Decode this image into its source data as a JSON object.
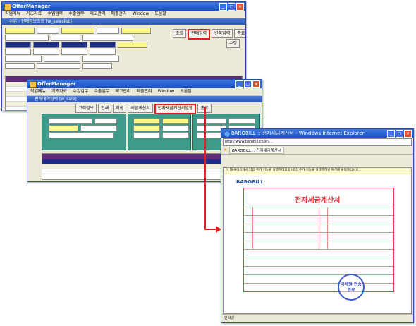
{
  "window1": {
    "title": "OfferManager",
    "menu": [
      "작업메뉴",
      "기초자료",
      "수입업무",
      "수출업무",
      "재고관리",
      "매출관리",
      "Window",
      "도움말"
    ],
    "subtitle": "수입 - 판매정보조회 [w_saleslist]",
    "toolbar": {
      "search": "조회",
      "sales_input": "판매입력",
      "return_input": "반품입력",
      "close": "종료",
      "print": "수정"
    }
  },
  "window2": {
    "title": "OfferManager",
    "menu": [
      "작업메뉴",
      "기초자료",
      "수입업무",
      "수출업무",
      "재고관리",
      "매출관리",
      "Window",
      "도움말"
    ],
    "subtitle": "판매내역입력 [w_sale]",
    "toolbar": {
      "customer": "고객정보",
      "print": "인쇄",
      "save": "저장",
      "tax_invoice": "세금계산서",
      "e_tax_invoice": "전자세금계산서발행",
      "close": "종료"
    }
  },
  "browser": {
    "title": "BAROBILL :: 전자세금계산서 - Windows Internet Explorer",
    "address": "http://www.barobill.co.kr/...",
    "tab": "BAROBILL :: 전자세금계산서",
    "infobar": "이 웹 사이트에서 다음 추가 기능을 실행하려고 합니다. 추가 기능을 실행하려면 여기를 클릭하십시오...",
    "logo": "BAROBILL",
    "document_title": "전자세금계산서",
    "stamp_text": "국세청 전송완료",
    "status": "인터넷"
  },
  "colors": {
    "accent_red": "#e02020",
    "title_blue": "#1c4fc4",
    "grid_header": "#5e2a7a",
    "selected_row": "#1b2e8c"
  }
}
